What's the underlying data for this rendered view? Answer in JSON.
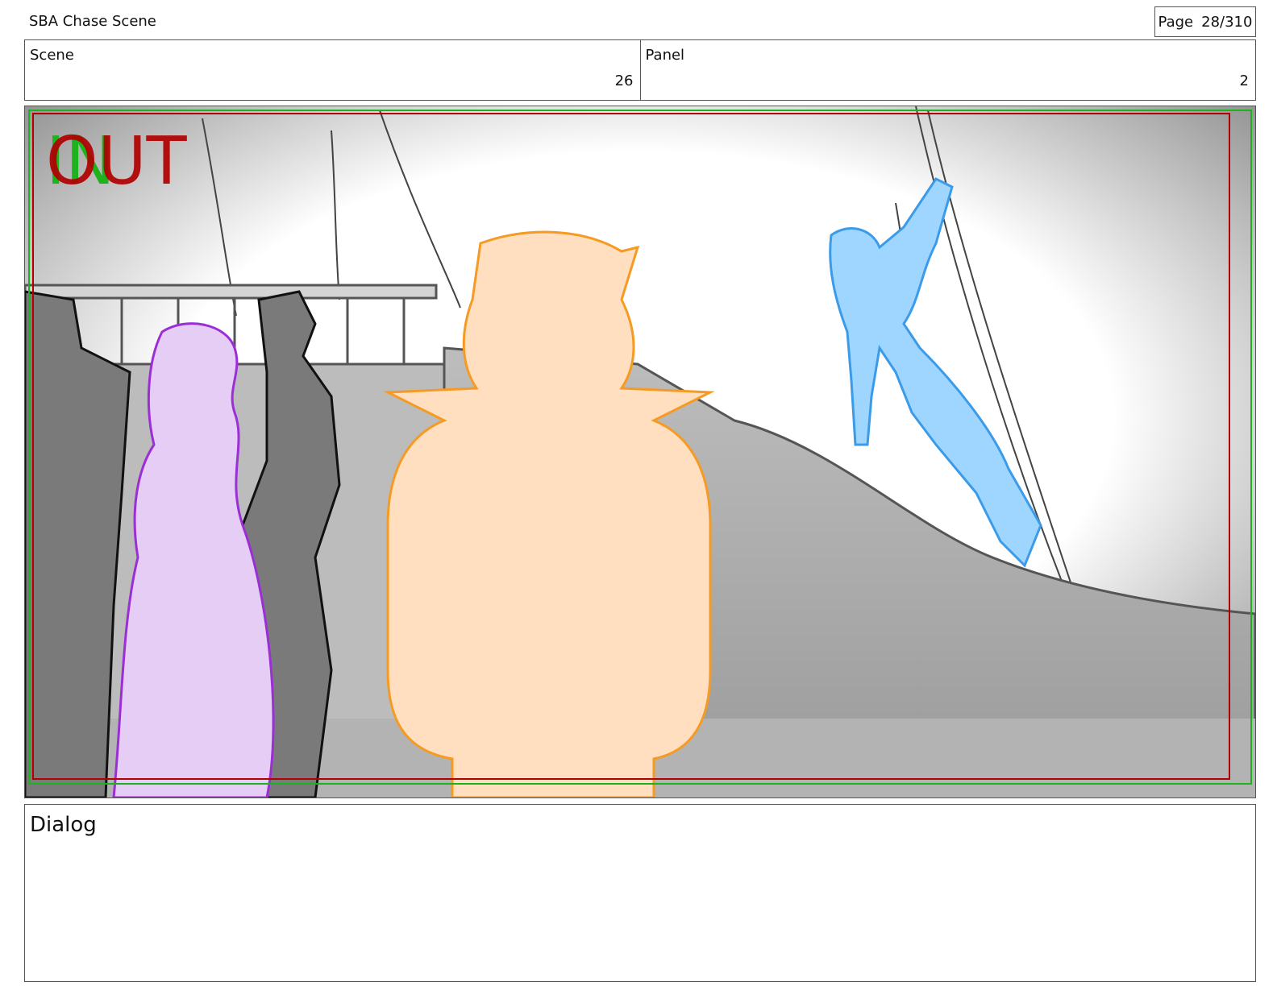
{
  "header": {
    "doc_title": "SBA Chase Scene",
    "page_label": "Page",
    "page_value": "28/310"
  },
  "meta": {
    "scene_label": "Scene",
    "scene_value": "26",
    "panel_label": "Panel",
    "panel_value": "2"
  },
  "panel_markers": {
    "in_text": "IN",
    "out_text": "OUT",
    "in_color": "#1db31d",
    "out_color": "#b00000"
  },
  "sketch_colors": {
    "character_orange": "#f59a23",
    "character_purple": "#9b2fd6",
    "character_blue": "#3c9be8",
    "crew_gray": "#555555"
  },
  "dialog": {
    "label": "Dialog"
  }
}
